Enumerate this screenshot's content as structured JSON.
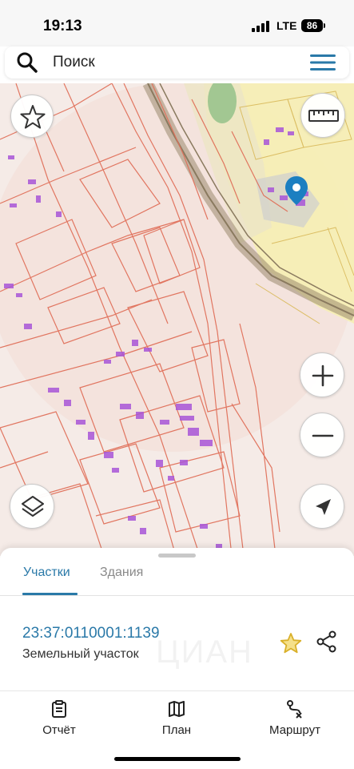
{
  "status_bar": {
    "time": "19:13",
    "network": "LTE",
    "battery": "86"
  },
  "search": {
    "placeholder": "Поиск"
  },
  "icons": {
    "search": "search-icon",
    "menu": "hamburger-menu-icon",
    "favorites": "star-outline-icon",
    "ruler": "ruler-icon",
    "zoom_in": "plus-icon",
    "zoom_out": "minus-icon",
    "layers": "layers-icon",
    "locate": "navigation-arrow-icon",
    "pin": "location-pin-icon",
    "favorite_plot": "star-icon",
    "share": "share-icon",
    "report": "report-clipboard-icon",
    "plan": "map-icon",
    "route": "route-icon"
  },
  "sheet": {
    "tabs": [
      {
        "label": "Участки",
        "active": true
      },
      {
        "label": "Здания",
        "active": false
      }
    ],
    "plot": {
      "number": "23:37:0110001:1139",
      "type": "Земельный участок"
    },
    "watermark": "ЦИАН"
  },
  "bottom_nav": {
    "items": [
      {
        "label": "Отчёт"
      },
      {
        "label": "План"
      },
      {
        "label": "Маршрут"
      }
    ]
  },
  "colors": {
    "accent": "#2a79a8",
    "parcel_border": "#e0705a",
    "building": "#a855d8",
    "highlight": "#f5e7a8",
    "pin": "#1c7fc1",
    "star": "#d9b02a"
  }
}
